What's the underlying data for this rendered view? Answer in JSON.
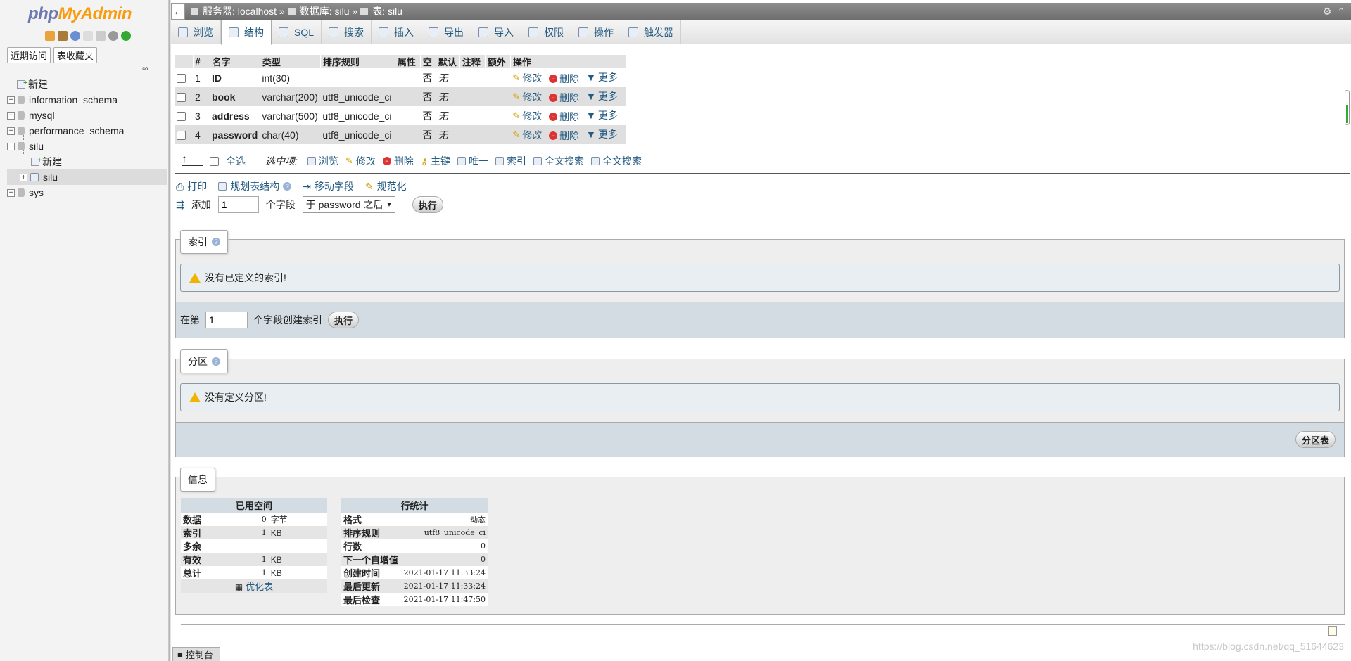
{
  "app": {
    "logo_php": "php",
    "logo_my": "MyAdmin"
  },
  "sidebar": {
    "nav_recent": "近期访问",
    "nav_favorites": "表收藏夹",
    "tree": [
      {
        "label": "新建",
        "type": "new"
      },
      {
        "label": "information_schema",
        "type": "db"
      },
      {
        "label": "mysql",
        "type": "db"
      },
      {
        "label": "performance_schema",
        "type": "db"
      },
      {
        "label": "silu",
        "type": "db"
      },
      {
        "label": "新建",
        "type": "new-sub"
      },
      {
        "label": "silu",
        "type": "table"
      },
      {
        "label": "sys",
        "type": "db"
      }
    ]
  },
  "topbar": {
    "server": "服务器: localhost »",
    "database": "数据库: silu »",
    "table": "表: silu"
  },
  "tabs": [
    "浏览",
    "结构",
    "SQL",
    "搜索",
    "插入",
    "导出",
    "导入",
    "权限",
    "操作",
    "触发器"
  ],
  "structure": {
    "headers": [
      "#",
      "名字",
      "类型",
      "排序规则",
      "属性",
      "空",
      "默认",
      "注释",
      "额外",
      "操作"
    ],
    "rows": [
      {
        "num": "1",
        "name": "ID",
        "type": "int(30)",
        "collation": "",
        "null": "否",
        "default": "无"
      },
      {
        "num": "2",
        "name": "book",
        "type": "varchar(200)",
        "collation": "utf8_unicode_ci",
        "null": "否",
        "default": "无"
      },
      {
        "num": "3",
        "name": "address",
        "type": "varchar(500)",
        "collation": "utf8_unicode_ci",
        "null": "否",
        "default": "无"
      },
      {
        "num": "4",
        "name": "password",
        "type": "char(40)",
        "collation": "utf8_unicode_ci",
        "null": "否",
        "default": "无"
      }
    ],
    "row_actions": {
      "edit": "修改",
      "drop": "删除",
      "more": "更多"
    }
  },
  "bulk": {
    "select_all": "全选",
    "selected_label": "选中项:",
    "actions": [
      "浏览",
      "修改",
      "删除",
      "主键",
      "唯一",
      "索引",
      "全文搜索",
      "全文搜索"
    ]
  },
  "ops": {
    "print": "打印",
    "propose": "规划表结构",
    "move": "移动字段",
    "normalize": "规范化"
  },
  "add_field": {
    "label": "添加",
    "value": "1",
    "unit": "个字段",
    "position": "于 password 之后",
    "go": "执行"
  },
  "indexes": {
    "legend": "索引",
    "notice": "没有已定义的索引!",
    "create_prefix": "在第",
    "create_value": "1",
    "create_suffix": "个字段创建索引",
    "go": "执行"
  },
  "partitions": {
    "legend": "分区",
    "notice": "没有定义分区!",
    "button": "分区表"
  },
  "info": {
    "legend": "信息",
    "space": {
      "header": "已用空间",
      "rows": [
        {
          "k": "数据",
          "v": "0",
          "u": "字节"
        },
        {
          "k": "索引",
          "v": "1",
          "u": "KB"
        },
        {
          "k": "多余",
          "v": "",
          "u": ""
        },
        {
          "k": "有效",
          "v": "1",
          "u": "KB"
        },
        {
          "k": "总计",
          "v": "1",
          "u": "KB"
        }
      ],
      "optimize": "优化表"
    },
    "stats": {
      "header": "行统计",
      "rows": [
        {
          "k": "格式",
          "v": "动态"
        },
        {
          "k": "排序规则",
          "v": "utf8_unicode_ci"
        },
        {
          "k": "行数",
          "v": "0"
        },
        {
          "k": "下一个自增值",
          "v": "0"
        },
        {
          "k": "创建时间",
          "v": "2021-01-17 11:33:24"
        },
        {
          "k": "最后更新",
          "v": "2021-01-17 11:33:24"
        },
        {
          "k": "最后检查",
          "v": "2021-01-17 11:47:50"
        }
      ]
    }
  },
  "console": "控制台",
  "watermark": "https://blog.csdn.net/qq_51644623"
}
